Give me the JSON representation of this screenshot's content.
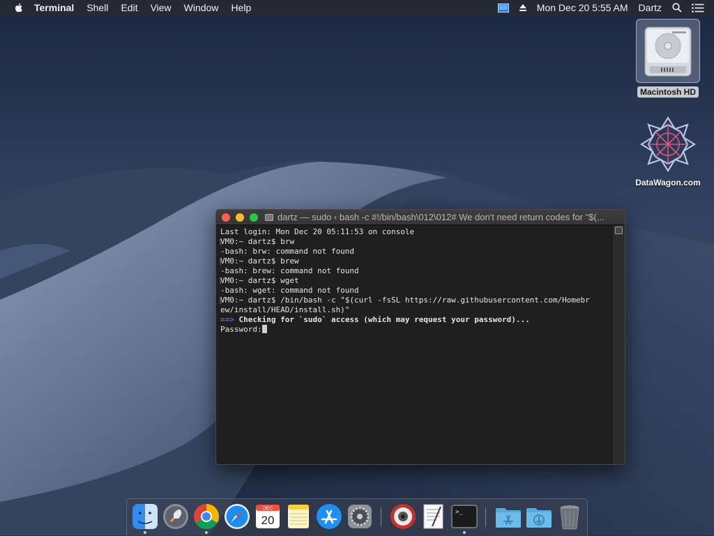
{
  "menubar": {
    "app_name": "Terminal",
    "menus": [
      "Shell",
      "Edit",
      "View",
      "Window",
      "Help"
    ],
    "clock": "Mon Dec 20  5:55 AM",
    "user": "Dartz"
  },
  "desktop": {
    "icons": [
      {
        "label": "Macintosh HD",
        "icon": "hard-drive-icon"
      },
      {
        "label": "DataWagon.com",
        "icon": "datawagon-logo-icon"
      }
    ]
  },
  "terminal": {
    "title": "dartz — sudo ‹ bash -c #!/bin/bash\\012\\012# We don't need return codes for \"$(...",
    "lines": [
      "Last login: Mon Dec 20 05:11:53 on console",
      "VM0:~ dartz$ brw",
      "-bash: brw: command not found",
      "VM0:~ dartz$ brew",
      "-bash: brew: command not found",
      "VM0:~ dartz$ wget",
      "-bash: wget: command not found",
      "VM0:~ dartz$ /bin/bash -c \"$(curl -fsSL https://raw.githubusercontent.com/Homebr",
      "ew/install/HEAD/install.sh)\""
    ],
    "sudo_arrow": "==>",
    "sudo_message": " Checking for `sudo` access (which may request your password)...",
    "password_prompt": "Password:"
  },
  "dock": {
    "apps": [
      {
        "name": "Finder",
        "icon": "finder-icon",
        "running": true
      },
      {
        "name": "Launchpad",
        "icon": "launchpad-icon",
        "running": false
      },
      {
        "name": "Google Chrome",
        "icon": "chrome-icon",
        "running": true
      },
      {
        "name": "Safari",
        "icon": "safari-icon",
        "running": false
      },
      {
        "name": "Calendar",
        "icon": "calendar-icon",
        "running": false,
        "month": "DEC",
        "day": "20"
      },
      {
        "name": "Notes",
        "icon": "notes-icon",
        "running": false
      },
      {
        "name": "App Store",
        "icon": "app-store-icon",
        "running": false
      },
      {
        "name": "System Preferences",
        "icon": "system-preferences-icon",
        "running": false
      },
      {
        "name": "Photo Booth",
        "icon": "photo-booth-icon",
        "running": false
      },
      {
        "name": "TextEdit",
        "icon": "textedit-icon",
        "running": false
      },
      {
        "name": "Terminal",
        "icon": "terminal-icon",
        "running": true
      },
      {
        "name": "Applications",
        "icon": "applications-folder-icon",
        "running": false
      },
      {
        "name": "Downloads",
        "icon": "downloads-folder-icon",
        "running": false
      },
      {
        "name": "Trash",
        "icon": "trash-icon",
        "running": false
      }
    ]
  },
  "colors": {
    "menubar_bg": "#262a34",
    "terminal_bg": "#1f1f1f",
    "prompt_arrow": "#6a5cff",
    "close": "#fe5f57",
    "minimize": "#febc2e",
    "zoom": "#28c840"
  }
}
